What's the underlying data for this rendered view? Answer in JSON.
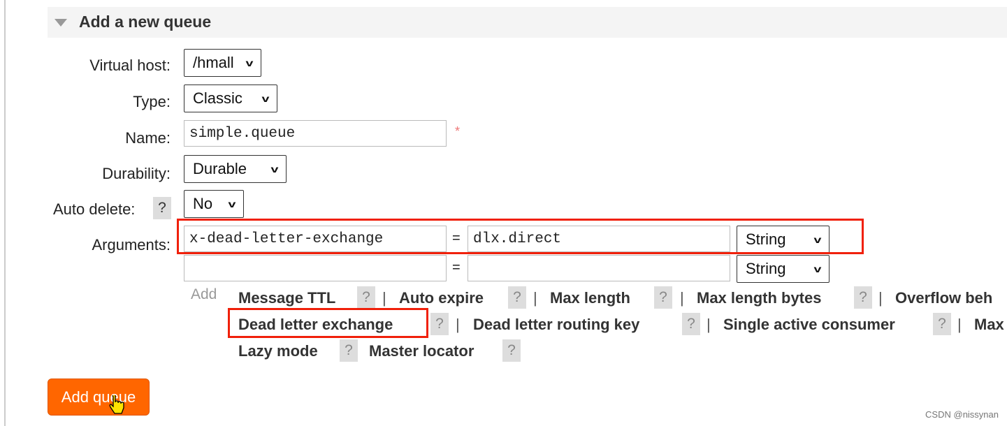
{
  "section": {
    "title": "Add a new queue"
  },
  "form": {
    "virtual_host": {
      "label": "Virtual host:",
      "value": "/hmall"
    },
    "type": {
      "label": "Type:",
      "value": "Classic"
    },
    "name": {
      "label": "Name:",
      "value": "simple.queue",
      "required_mark": "*"
    },
    "durability": {
      "label": "Durability:",
      "value": "Durable"
    },
    "auto_delete": {
      "label": "Auto delete:",
      "help": "?",
      "value": "No"
    },
    "arguments": {
      "label": "Arguments:",
      "eq": "=",
      "rows": [
        {
          "key": "x-dead-letter-exchange",
          "value": "dlx.direct",
          "type": "String"
        },
        {
          "key": "",
          "value": "",
          "type": "String"
        }
      ]
    },
    "add_label": "Add",
    "help": "?",
    "sep": "|",
    "shortcuts": [
      "Message TTL",
      "Auto expire",
      "Max length",
      "Max length bytes",
      "Overflow beh",
      "Dead letter exchange",
      "Dead letter routing key",
      "Single active consumer",
      "Max",
      "Lazy mode",
      "Master locator"
    ]
  },
  "submit": {
    "label": "Add queue"
  },
  "watermark": "CSDN @nissynan",
  "colors": {
    "button": "#ff6600",
    "highlight": "#f0200a"
  }
}
